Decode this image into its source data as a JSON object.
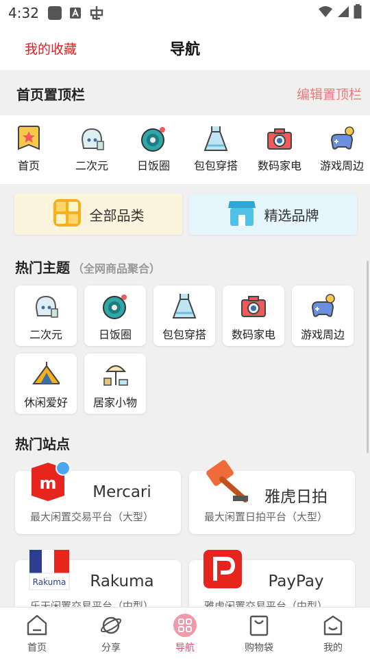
{
  "status_bar": {
    "time": "4:32"
  },
  "header": {
    "left_link": "我的收藏",
    "title": "导航"
  },
  "pinned": {
    "title": "首页置顶栏",
    "edit_label": "编辑置顶栏",
    "items": [
      {
        "label": "首页",
        "icon": "home-star-icon"
      },
      {
        "label": "二次元",
        "icon": "anime-girl-icon"
      },
      {
        "label": "日饭圈",
        "icon": "vinyl-record-icon"
      },
      {
        "label": "包包穿搭",
        "icon": "dress-icon"
      },
      {
        "label": "数码家电",
        "icon": "camera-icon"
      },
      {
        "label": "游戏周边",
        "icon": "gamepad-icon"
      }
    ]
  },
  "categories": {
    "all": "全部品类",
    "brand": "精选品牌"
  },
  "hot_topics": {
    "title": "热门主题",
    "subtitle": "（全网商品聚合）",
    "items": [
      {
        "label": "二次元",
        "icon": "anime-girl-icon"
      },
      {
        "label": "日饭圈",
        "icon": "vinyl-record-icon"
      },
      {
        "label": "包包穿搭",
        "icon": "dress-icon"
      },
      {
        "label": "数码家电",
        "icon": "camera-icon"
      },
      {
        "label": "游戏周边",
        "icon": "gamepad-icon"
      },
      {
        "label": "休闲爱好",
        "icon": "tent-icon"
      },
      {
        "label": "居家小物",
        "icon": "parasol-icon"
      }
    ]
  },
  "hot_sites": {
    "title": "热门站点",
    "items": [
      {
        "name": "Mercari",
        "desc": "最大闲置交易平台（大型）",
        "logo": "mercari-logo"
      },
      {
        "name": "雅虎日拍",
        "desc": "最大闲置日拍平台（大型）",
        "logo": "auction-gavel-logo"
      },
      {
        "name": "Rakuma",
        "desc": "乐天闲置交易平台（中型）",
        "logo": "rakuma-logo",
        "logo_text": "Rakuma"
      },
      {
        "name": "PayPay",
        "desc": "雅虎闲置交易平台（中型）",
        "logo": "paypay-logo"
      }
    ]
  },
  "bottom_nav": {
    "items": [
      {
        "label": "首页",
        "icon": "home-icon"
      },
      {
        "label": "分享",
        "icon": "planet-icon"
      },
      {
        "label": "导航",
        "icon": "grid-icon",
        "active": true
      },
      {
        "label": "购物袋",
        "icon": "shopping-bag-icon"
      },
      {
        "label": "我的",
        "icon": "profile-icon"
      }
    ]
  },
  "colors": {
    "accent": "#e02020",
    "active_nav": "#e0506a",
    "edit_link": "#f07a7a"
  }
}
